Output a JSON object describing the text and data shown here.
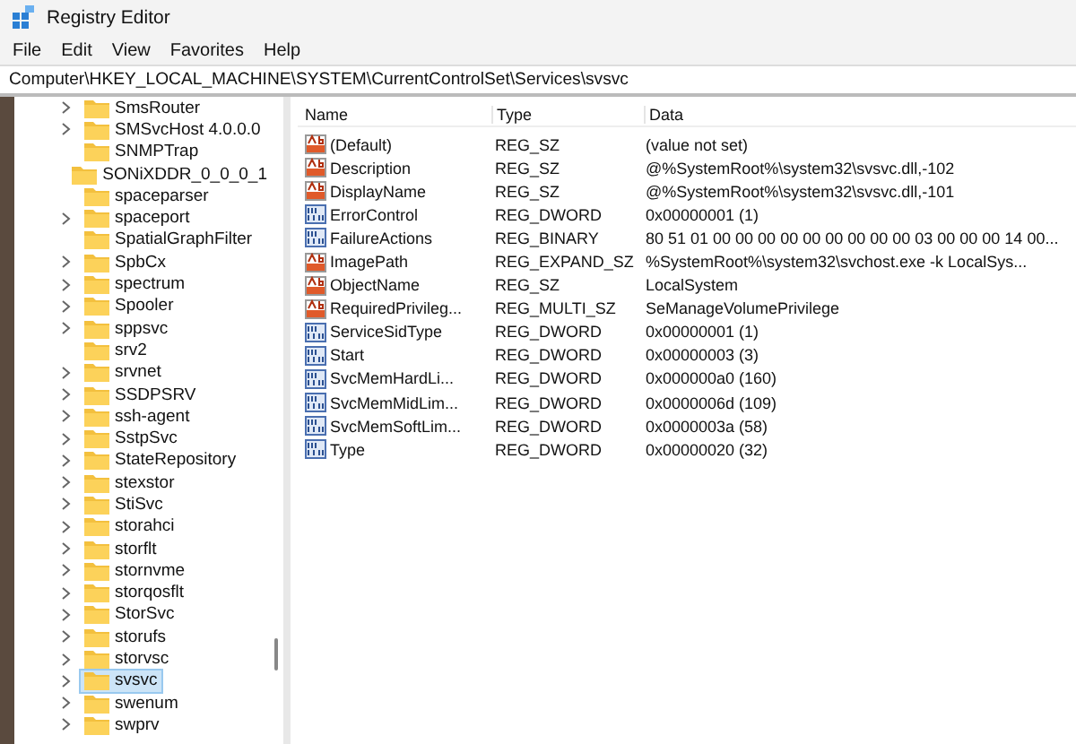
{
  "window": {
    "title": "Registry Editor"
  },
  "menu": [
    "File",
    "Edit",
    "View",
    "Favorites",
    "Help"
  ],
  "address": "Computer\\HKEY_LOCAL_MACHINE\\SYSTEM\\CurrentControlSet\\Services\\svsvc",
  "tree": [
    {
      "label": "SmsRouter",
      "expandable": true,
      "selected": false
    },
    {
      "label": "SMSvcHost 4.0.0.0",
      "expandable": true,
      "selected": false
    },
    {
      "label": "SNMPTrap",
      "expandable": false,
      "selected": false
    },
    {
      "label": "SONiXDDR_0_0_0_1",
      "expandable": false,
      "selected": false
    },
    {
      "label": "spaceparser",
      "expandable": false,
      "selected": false
    },
    {
      "label": "spaceport",
      "expandable": true,
      "selected": false
    },
    {
      "label": "SpatialGraphFilter",
      "expandable": false,
      "selected": false
    },
    {
      "label": "SpbCx",
      "expandable": true,
      "selected": false
    },
    {
      "label": "spectrum",
      "expandable": true,
      "selected": false
    },
    {
      "label": "Spooler",
      "expandable": true,
      "selected": false
    },
    {
      "label": "sppsvc",
      "expandable": true,
      "selected": false
    },
    {
      "label": "srv2",
      "expandable": false,
      "selected": false
    },
    {
      "label": "srvnet",
      "expandable": true,
      "selected": false
    },
    {
      "label": "SSDPSRV",
      "expandable": true,
      "selected": false
    },
    {
      "label": "ssh-agent",
      "expandable": true,
      "selected": false
    },
    {
      "label": "SstpSvc",
      "expandable": true,
      "selected": false
    },
    {
      "label": "StateRepository",
      "expandable": true,
      "selected": false
    },
    {
      "label": "stexstor",
      "expandable": true,
      "selected": false
    },
    {
      "label": "StiSvc",
      "expandable": true,
      "selected": false
    },
    {
      "label": "storahci",
      "expandable": true,
      "selected": false
    },
    {
      "label": "storflt",
      "expandable": true,
      "selected": false
    },
    {
      "label": "stornvme",
      "expandable": true,
      "selected": false
    },
    {
      "label": "storqosflt",
      "expandable": true,
      "selected": false
    },
    {
      "label": "StorSvc",
      "expandable": true,
      "selected": false
    },
    {
      "label": "storufs",
      "expandable": true,
      "selected": false
    },
    {
      "label": "storvsc",
      "expandable": true,
      "selected": false
    },
    {
      "label": "svsvc",
      "expandable": true,
      "selected": true
    },
    {
      "label": "swenum",
      "expandable": true,
      "selected": false
    },
    {
      "label": "swprv",
      "expandable": true,
      "selected": false
    }
  ],
  "values": {
    "columns": [
      "Name",
      "Type",
      "Data"
    ],
    "rows": [
      {
        "kind": "string",
        "name": "(Default)",
        "type": "REG_SZ",
        "data": "(value not set)"
      },
      {
        "kind": "string",
        "name": "Description",
        "type": "REG_SZ",
        "data": "@%SystemRoot%\\system32\\svsvc.dll,-102"
      },
      {
        "kind": "string",
        "name": "DisplayName",
        "type": "REG_SZ",
        "data": "@%SystemRoot%\\system32\\svsvc.dll,-101"
      },
      {
        "kind": "binary",
        "name": "ErrorControl",
        "type": "REG_DWORD",
        "data": "0x00000001 (1)"
      },
      {
        "kind": "binary",
        "name": "FailureActions",
        "type": "REG_BINARY",
        "data": "80 51 01 00 00 00 00 00 00 00 00 00 03 00 00 00 14 00..."
      },
      {
        "kind": "string",
        "name": "ImagePath",
        "type": "REG_EXPAND_SZ",
        "data": "%SystemRoot%\\system32\\svchost.exe -k LocalSys..."
      },
      {
        "kind": "string",
        "name": "ObjectName",
        "type": "REG_SZ",
        "data": "LocalSystem"
      },
      {
        "kind": "string",
        "name": "RequiredPrivileg...",
        "type": "REG_MULTI_SZ",
        "data": "SeManageVolumePrivilege"
      },
      {
        "kind": "binary",
        "name": "ServiceSidType",
        "type": "REG_DWORD",
        "data": "0x00000001 (1)"
      },
      {
        "kind": "binary",
        "name": "Start",
        "type": "REG_DWORD",
        "data": "0x00000003 (3)"
      },
      {
        "kind": "binary",
        "name": "SvcMemHardLi...",
        "type": "REG_DWORD",
        "data": "0x000000a0 (160)"
      },
      {
        "kind": "binary",
        "name": "SvcMemMidLim...",
        "type": "REG_DWORD",
        "data": "0x0000006d (109)"
      },
      {
        "kind": "binary",
        "name": "SvcMemSoftLim...",
        "type": "REG_DWORD",
        "data": "0x0000003a (58)"
      },
      {
        "kind": "binary",
        "name": "Type",
        "type": "REG_DWORD",
        "data": "0x00000020 (32)"
      }
    ]
  }
}
